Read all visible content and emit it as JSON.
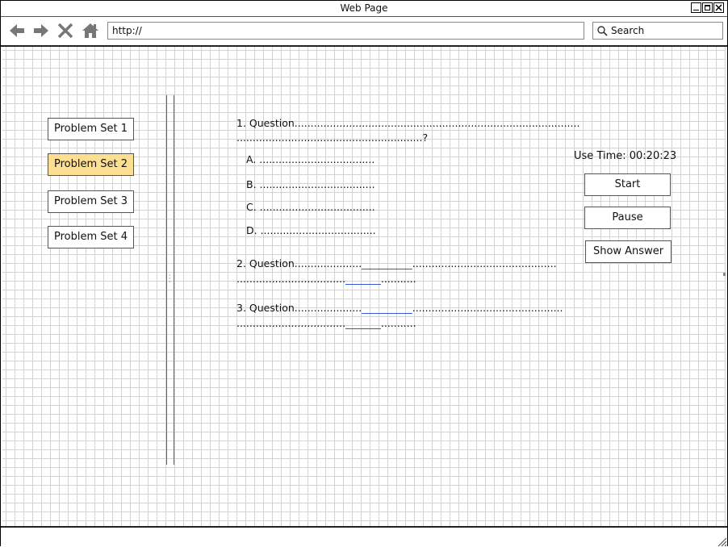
{
  "window": {
    "title": "Web Page"
  },
  "browser": {
    "url": "http://",
    "search_placeholder": "Search"
  },
  "sidebar": {
    "items": [
      {
        "label": "Problem Set 1",
        "active": false
      },
      {
        "label": "Problem Set 2",
        "active": true
      },
      {
        "label": "Problem Set 3",
        "active": false
      },
      {
        "label": "Problem Set 4",
        "active": false
      }
    ]
  },
  "questions": {
    "q1": {
      "line1": "1. Question.........................................................................................",
      "line2": "..........................................................?",
      "options": [
        "A. ....................................",
        "B. ....................................",
        "C. ....................................",
        "D. ...................................."
      ]
    },
    "q2": {
      "line1_a": "2. Question.....................",
      "line1_blank": "__________",
      "line1_b": ".............................................",
      "line2_a": "..................................",
      "line2_blank": "_______",
      "line2_b": "..........."
    },
    "q3": {
      "line1_a": "3. Question.....................",
      "line1_blank": "__________",
      "line1_b": "...............................................",
      "line2_a": "..................................",
      "line2_blank": "_______",
      "line2_b": "..........."
    }
  },
  "timer": {
    "label": "Use Time: 00:20:23"
  },
  "controls": {
    "start": "Start",
    "pause": "Pause",
    "show_answer": "Show Answer"
  },
  "colors": {
    "active_item": "#fddf92",
    "blank_link": "#1a3fd0"
  }
}
